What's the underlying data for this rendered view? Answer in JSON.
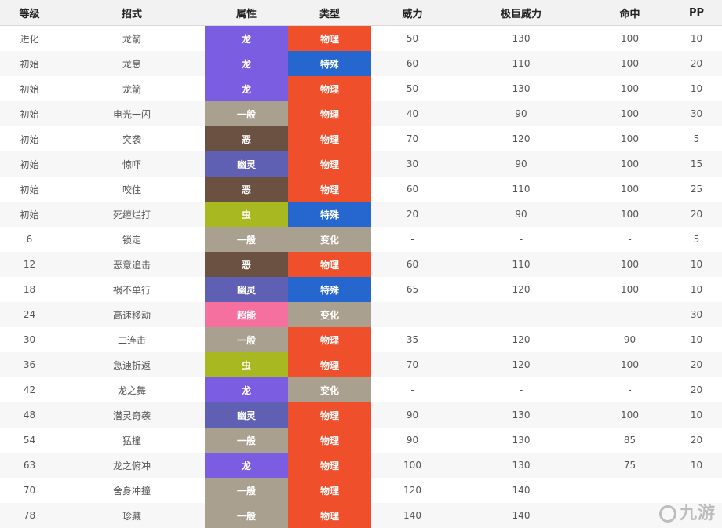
{
  "headers": {
    "level": "等级",
    "move": "招式",
    "attribute": "属性",
    "category": "类型",
    "power": "威力",
    "max_power": "极巨威力",
    "accuracy": "命中",
    "pp": "PP"
  },
  "colors": {
    "龙": "#7a5de0",
    "一般": "#a9a08f",
    "恶": "#6a5142",
    "幽灵": "#5f5fb3",
    "虫": "#a8b820",
    "超能": "#f56f9f",
    "物理": "#ef4f2b",
    "特殊": "#2566cf",
    "变化": "#a9a08f"
  },
  "rows": [
    {
      "level": "进化",
      "move": "龙箭",
      "attribute": "龙",
      "category": "物理",
      "power": "50",
      "max_power": "130",
      "accuracy": "100",
      "pp": "10"
    },
    {
      "level": "初始",
      "move": "龙息",
      "attribute": "龙",
      "category": "特殊",
      "power": "60",
      "max_power": "110",
      "accuracy": "100",
      "pp": "20"
    },
    {
      "level": "初始",
      "move": "龙箭",
      "attribute": "龙",
      "category": "物理",
      "power": "50",
      "max_power": "130",
      "accuracy": "100",
      "pp": "10"
    },
    {
      "level": "初始",
      "move": "电光一闪",
      "attribute": "一般",
      "category": "物理",
      "power": "40",
      "max_power": "90",
      "accuracy": "100",
      "pp": "30"
    },
    {
      "level": "初始",
      "move": "突袭",
      "attribute": "恶",
      "category": "物理",
      "power": "70",
      "max_power": "120",
      "accuracy": "100",
      "pp": "5"
    },
    {
      "level": "初始",
      "move": "惊吓",
      "attribute": "幽灵",
      "category": "物理",
      "power": "30",
      "max_power": "90",
      "accuracy": "100",
      "pp": "15"
    },
    {
      "level": "初始",
      "move": "咬住",
      "attribute": "恶",
      "category": "物理",
      "power": "60",
      "max_power": "110",
      "accuracy": "100",
      "pp": "25"
    },
    {
      "level": "初始",
      "move": "死缠烂打",
      "attribute": "虫",
      "category": "特殊",
      "power": "20",
      "max_power": "90",
      "accuracy": "100",
      "pp": "20"
    },
    {
      "level": "6",
      "move": "锁定",
      "attribute": "一般",
      "category": "变化",
      "power": "-",
      "max_power": "-",
      "accuracy": "-",
      "pp": "5"
    },
    {
      "level": "12",
      "move": "恶意追击",
      "attribute": "恶",
      "category": "物理",
      "power": "60",
      "max_power": "110",
      "accuracy": "100",
      "pp": "10"
    },
    {
      "level": "18",
      "move": "祸不单行",
      "attribute": "幽灵",
      "category": "特殊",
      "power": "65",
      "max_power": "120",
      "accuracy": "100",
      "pp": "10"
    },
    {
      "level": "24",
      "move": "高速移动",
      "attribute": "超能",
      "category": "变化",
      "power": "-",
      "max_power": "-",
      "accuracy": "-",
      "pp": "30"
    },
    {
      "level": "30",
      "move": "二连击",
      "attribute": "一般",
      "category": "物理",
      "power": "35",
      "max_power": "120",
      "accuracy": "90",
      "pp": "10"
    },
    {
      "level": "36",
      "move": "急速折返",
      "attribute": "虫",
      "category": "物理",
      "power": "70",
      "max_power": "120",
      "accuracy": "100",
      "pp": "20"
    },
    {
      "level": "42",
      "move": "龙之舞",
      "attribute": "龙",
      "category": "变化",
      "power": "-",
      "max_power": "-",
      "accuracy": "-",
      "pp": "20"
    },
    {
      "level": "48",
      "move": "潜灵奇袭",
      "attribute": "幽灵",
      "category": "物理",
      "power": "90",
      "max_power": "130",
      "accuracy": "100",
      "pp": "10"
    },
    {
      "level": "54",
      "move": "猛撞",
      "attribute": "一般",
      "category": "物理",
      "power": "90",
      "max_power": "130",
      "accuracy": "85",
      "pp": "20"
    },
    {
      "level": "63",
      "move": "龙之俯冲",
      "attribute": "龙",
      "category": "物理",
      "power": "100",
      "max_power": "130",
      "accuracy": "75",
      "pp": "10"
    },
    {
      "level": "70",
      "move": "舍身冲撞",
      "attribute": "一般",
      "category": "物理",
      "power": "120",
      "max_power": "140",
      "accuracy": "",
      "pp": ""
    },
    {
      "level": "78",
      "move": "珍藏",
      "attribute": "一般",
      "category": "物理",
      "power": "140",
      "max_power": "140",
      "accuracy": "",
      "pp": ""
    }
  ],
  "watermark": {
    "text": "九游"
  }
}
